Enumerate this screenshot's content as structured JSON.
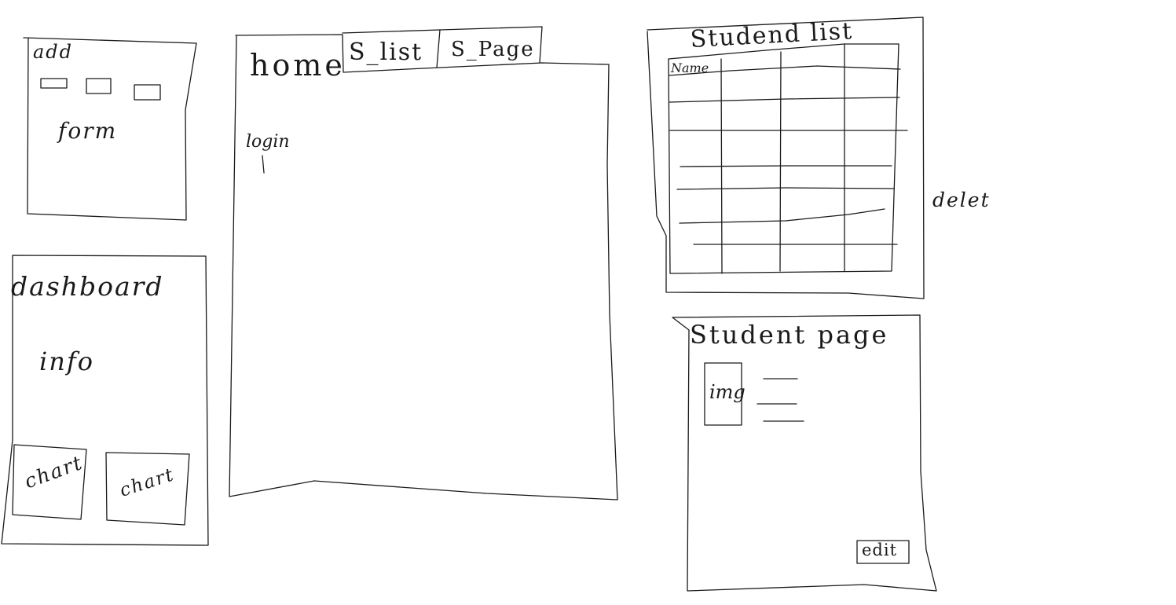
{
  "add_panel": {
    "title": "add",
    "label": "form"
  },
  "dashboard_panel": {
    "title": "dashboard",
    "info_label": "info",
    "chart_labels": [
      "chart",
      "chart"
    ]
  },
  "home_panel": {
    "tabs": [
      {
        "label": "home"
      },
      {
        "label": "S_list"
      },
      {
        "label": "S_Page"
      }
    ],
    "login_label": "login"
  },
  "student_list_panel": {
    "title": "Studend list",
    "first_column_header": "Name",
    "side_label": "delet"
  },
  "student_page_panel": {
    "title": "Student page",
    "image_label": "img",
    "edit_label": "edit"
  }
}
